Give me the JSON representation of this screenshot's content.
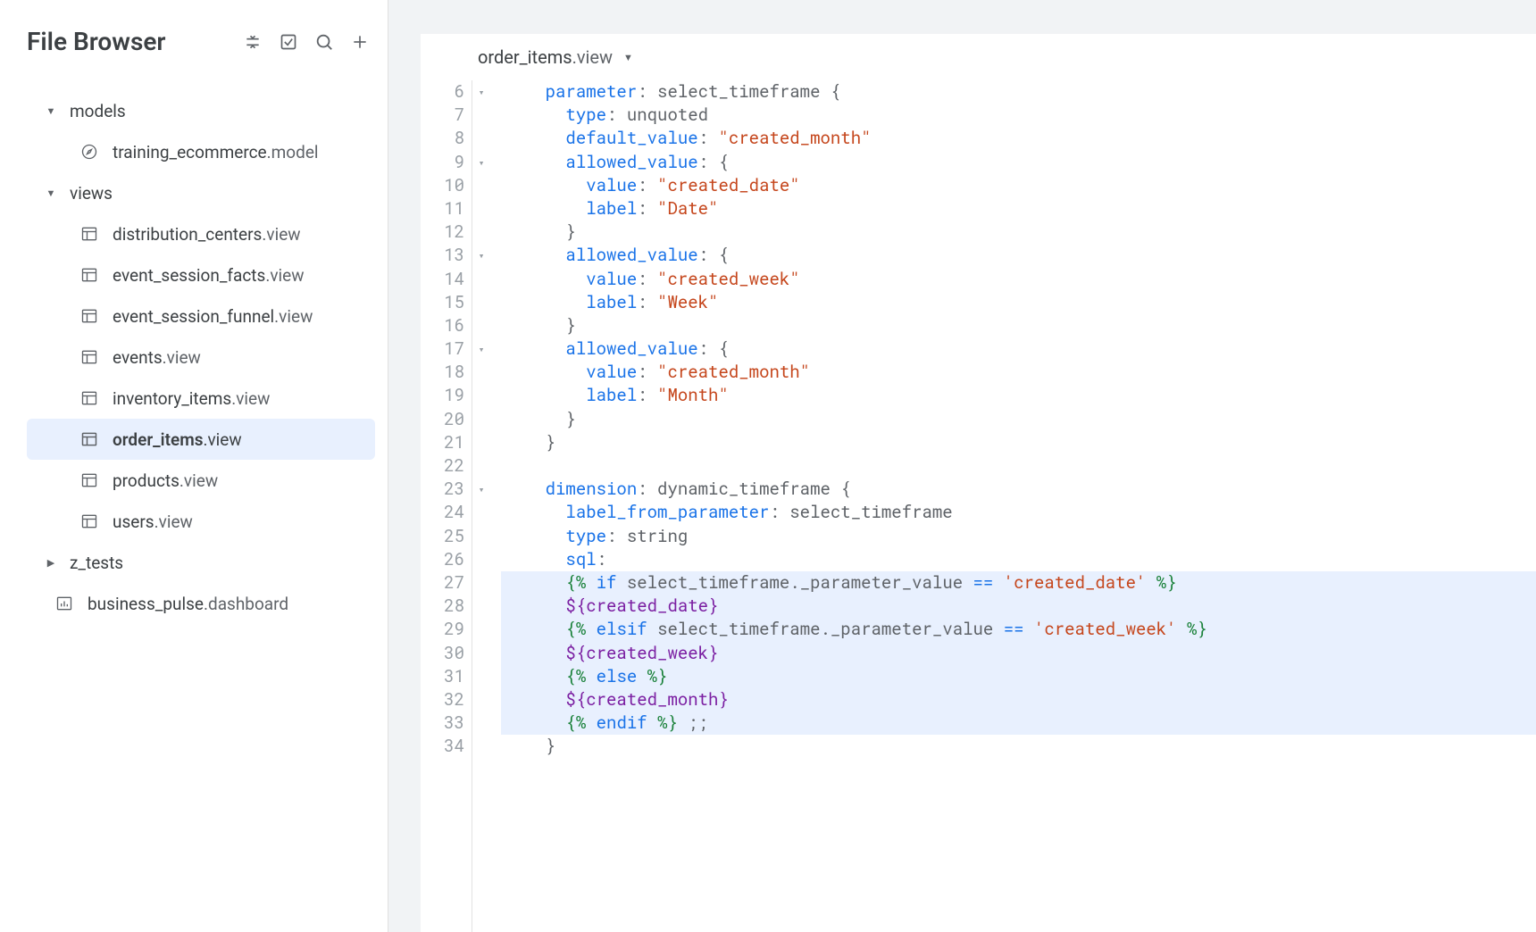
{
  "sidebar": {
    "title": "File Browser",
    "folders": {
      "models": "models",
      "views": "views",
      "z_tests": "z_tests"
    },
    "model_item": {
      "name": "training_ecommerce",
      "ext": ".model"
    },
    "view_items": [
      {
        "name": "distribution_centers",
        "ext": ".view"
      },
      {
        "name": "event_session_facts",
        "ext": ".view"
      },
      {
        "name": "event_session_funnel",
        "ext": ".view"
      },
      {
        "name": "events",
        "ext": ".view"
      },
      {
        "name": "inventory_items",
        "ext": ".view"
      },
      {
        "name": "order_items",
        "ext": ".view"
      },
      {
        "name": "products",
        "ext": ".view"
      },
      {
        "name": "users",
        "ext": ".view"
      }
    ],
    "dashboard_item": {
      "name": "business_pulse",
      "ext": ".dashboard"
    }
  },
  "tab": {
    "name": "order_items",
    "ext": ".view"
  },
  "code": {
    "line_numbers": [
      "6",
      "7",
      "8",
      "9",
      "10",
      "11",
      "12",
      "13",
      "14",
      "15",
      "16",
      "17",
      "18",
      "19",
      "20",
      "21",
      "22",
      "23",
      "24",
      "25",
      "26",
      "27",
      "28",
      "29",
      "30",
      "31",
      "32",
      "33",
      "34"
    ],
    "fold_markers": {
      "0": "▾",
      "3": "▾",
      "7": "▾",
      "11": "▾",
      "17": "▾"
    },
    "tokens": {
      "parameter": "parameter",
      "select_timeframe": "select_timeframe",
      "type": "type",
      "unquoted": "unquoted",
      "default_value": "default_value",
      "created_month_str": "\"created_month\"",
      "allowed_value": "allowed_value",
      "value": "value",
      "label": "label",
      "created_date_str": "\"created_date\"",
      "date_str": "\"Date\"",
      "created_week_str": "\"created_week\"",
      "week_str": "\"Week\"",
      "month_str": "\"Month\"",
      "dimension": "dimension",
      "dynamic_timeframe": "dynamic_timeframe",
      "label_from_parameter": "label_from_parameter",
      "string": "string",
      "sql": "sql",
      "if": "if",
      "elsif": "elsif",
      "else": "else",
      "endif": "endif",
      "param_val": "select_timeframe._parameter_value",
      "eq": "==",
      "created_date_sq": "'created_date'",
      "created_week_sq": "'created_week'",
      "var_created_date": "${created_date}",
      "var_created_week": "${created_week}",
      "var_created_month": "${created_month}",
      "ldelim": "{%",
      "rdelim": "%}",
      "semisemi": ";;",
      "lbrace": "{",
      "rbrace": "}",
      "colon": ":"
    }
  }
}
